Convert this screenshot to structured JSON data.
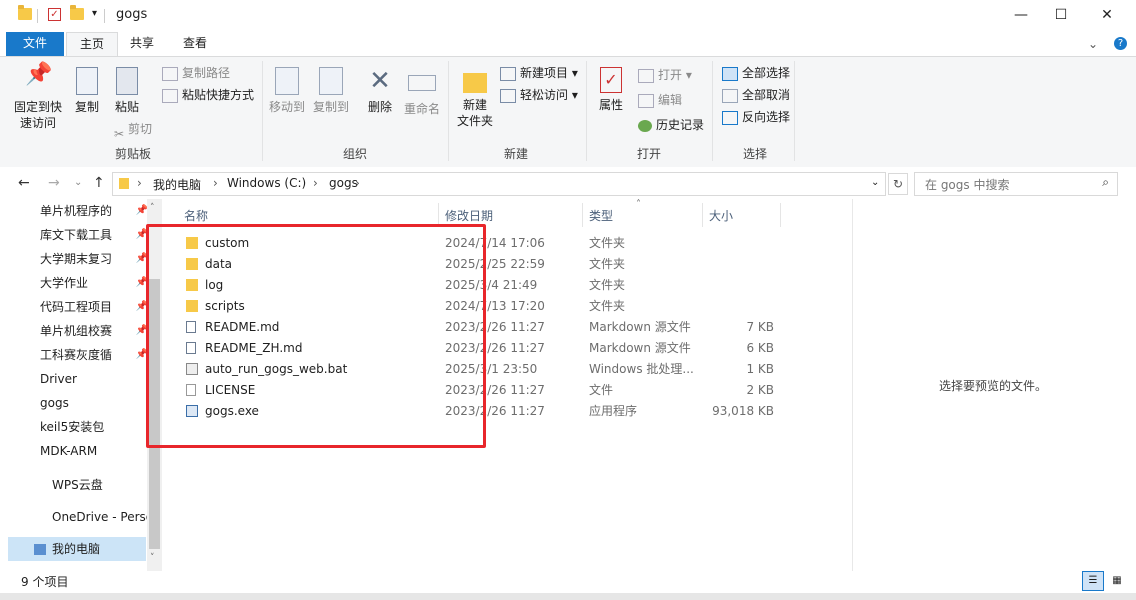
{
  "window": {
    "title": "gogs",
    "minimize": "—",
    "maximize": "☐",
    "close": "✕"
  },
  "ribbon_tabs": [
    "文件",
    "主页",
    "共享",
    "查看"
  ],
  "ribbon": {
    "clipboard": {
      "pin_quick_access": "固定到快\n速访问",
      "copy": "复制",
      "paste": "粘贴",
      "copy_path": "复制路径",
      "paste_shortcut": "粘贴快捷方式",
      "cut": "剪切",
      "label": "剪贴板"
    },
    "organize": {
      "move_to": "移动到",
      "copy_to": "复制到",
      "delete": "删除",
      "rename": "重命名",
      "label": "组织"
    },
    "new": {
      "new_folder": "新建\n文件夹",
      "new_item": "新建项目",
      "easy_access": "轻松访问",
      "label": "新建"
    },
    "open": {
      "properties": "属性",
      "open": "打开",
      "edit": "编辑",
      "history": "历史记录",
      "label": "打开"
    },
    "select": {
      "select_all": "全部选择",
      "select_none": "全部取消",
      "invert": "反向选择",
      "label": "选择"
    }
  },
  "address": {
    "breadcrumbs": [
      "我的电脑",
      "Windows (C:)",
      "gogs"
    ],
    "search_placeholder": "在 gogs 中搜索"
  },
  "nav_items": [
    {
      "label": "单片机程序的",
      "pinned": true
    },
    {
      "label": "库文下载工具",
      "pinned": true
    },
    {
      "label": "大学期末复习",
      "pinned": true
    },
    {
      "label": "大学作业",
      "pinned": true
    },
    {
      "label": "代码工程项目",
      "pinned": true
    },
    {
      "label": "单片机组校赛",
      "pinned": true
    },
    {
      "label": "工科赛灰度循",
      "pinned": true
    },
    {
      "label": "Driver",
      "pinned": false
    },
    {
      "label": "gogs",
      "pinned": false
    },
    {
      "label": "keil5安装包",
      "pinned": false
    },
    {
      "label": "MDK-ARM",
      "pinned": false
    },
    {
      "label": "WPS云盘",
      "pinned": false
    },
    {
      "label": "OneDrive - Perso",
      "pinned": false
    },
    {
      "label": "我的电脑",
      "pinned": false
    }
  ],
  "columns": {
    "name": "名称",
    "date": "修改日期",
    "type": "类型",
    "size": "大小"
  },
  "files": [
    {
      "name": "custom",
      "date": "2024/7/14 17:06",
      "type": "文件夹",
      "size": "",
      "icon": "folder"
    },
    {
      "name": "data",
      "date": "2025/2/25 22:59",
      "type": "文件夹",
      "size": "",
      "icon": "folder"
    },
    {
      "name": "log",
      "date": "2025/3/4 21:49",
      "type": "文件夹",
      "size": "",
      "icon": "folder"
    },
    {
      "name": "scripts",
      "date": "2024/7/13 17:20",
      "type": "文件夹",
      "size": "",
      "icon": "folder"
    },
    {
      "name": "README.md",
      "date": "2023/2/26 11:27",
      "type": "Markdown 源文件",
      "size": "7 KB",
      "icon": "markdown"
    },
    {
      "name": "README_ZH.md",
      "date": "2023/2/26 11:27",
      "type": "Markdown 源文件",
      "size": "6 KB",
      "icon": "markdown"
    },
    {
      "name": "auto_run_gogs_web.bat",
      "date": "2025/3/1 23:50",
      "type": "Windows 批处理...",
      "size": "1 KB",
      "icon": "batch"
    },
    {
      "name": "LICENSE",
      "date": "2023/2/26 11:27",
      "type": "文件",
      "size": "2 KB",
      "icon": "file"
    },
    {
      "name": "gogs.exe",
      "date": "2023/2/26 11:27",
      "type": "应用程序",
      "size": "93,018 KB",
      "icon": "exe"
    }
  ],
  "preview": {
    "message": "选择要预览的文件。"
  },
  "status": {
    "item_count": "9 个项目"
  },
  "colors": {
    "accent": "#1979ca",
    "folder": "#f7c948",
    "highlight_box": "#e8262b"
  }
}
